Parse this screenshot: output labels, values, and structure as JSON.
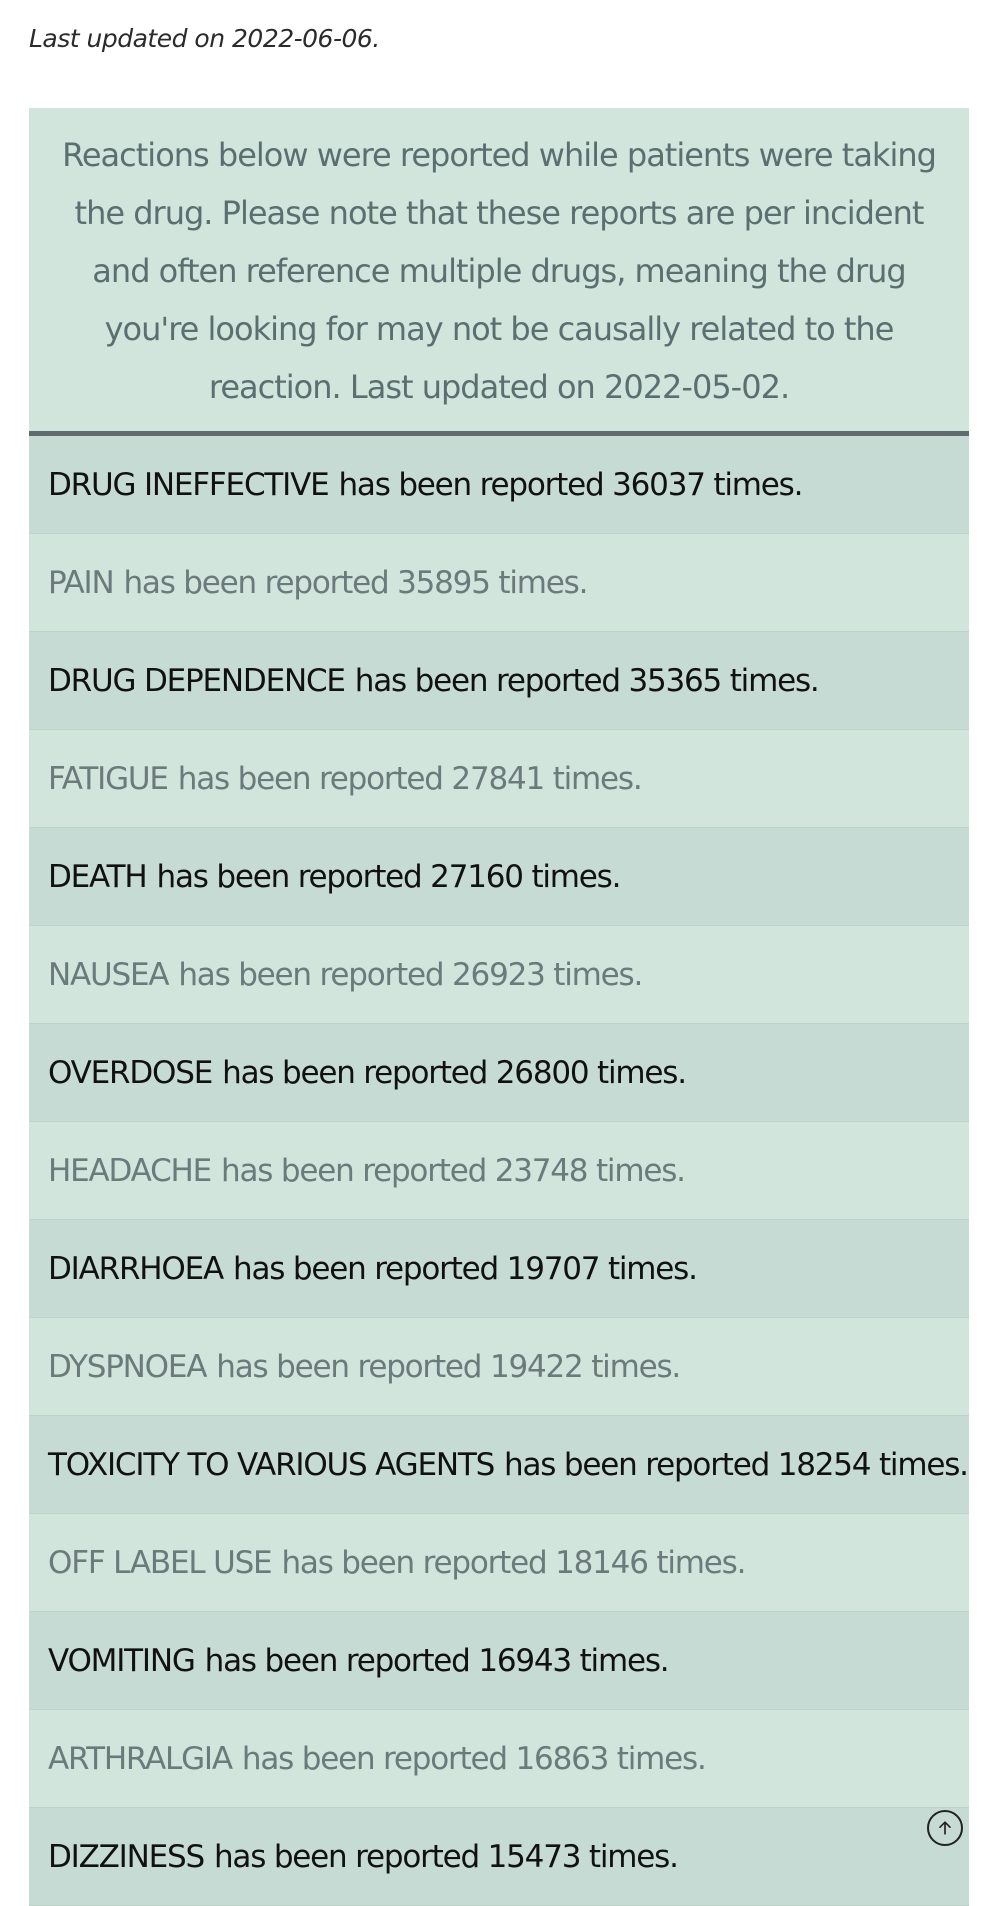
{
  "last_updated": "Last updated on 2022-06-06.",
  "intro": "Reactions below were reported while patients were taking the drug. Please note that these reports are per incident and often reference multiple drugs, meaning the drug you're looking for may not be causally related to the reaction. Last updated on 2022-05-02.",
  "reactions": [
    {
      "name": "DRUG INEFFECTIVE",
      "suffix": "has been reported 36037 times."
    },
    {
      "name": "PAIN",
      "suffix": "has been reported 35895 times."
    },
    {
      "name": "DRUG DEPENDENCE",
      "suffix": "has been reported 35365 times."
    },
    {
      "name": "FATIGUE",
      "suffix": "has been reported 27841 times."
    },
    {
      "name": "DEATH",
      "suffix": "has been reported 27160 times."
    },
    {
      "name": "NAUSEA",
      "suffix": "has been reported 26923 times."
    },
    {
      "name": "OVERDOSE",
      "suffix": "has been reported 26800 times."
    },
    {
      "name": "HEADACHE",
      "suffix": "has been reported 23748 times."
    },
    {
      "name": "DIARRHOEA",
      "suffix": "has been reported 19707 times."
    },
    {
      "name": "DYSPNOEA",
      "suffix": "has been reported 19422 times."
    },
    {
      "name": "TOXICITY TO VARIOUS AGENTS",
      "suffix": "has been reported 18254 times."
    },
    {
      "name": "OFF LABEL USE",
      "suffix": "has been reported 18146 times."
    },
    {
      "name": "VOMITING",
      "suffix": "has been reported 16943 times."
    },
    {
      "name": "ARTHRALGIA",
      "suffix": "has been reported 16863 times."
    },
    {
      "name": "DIZZINESS",
      "suffix": "has been reported 15473 times."
    }
  ],
  "scroll_top_icon": "arrow-up-circle-icon",
  "colors": {
    "row_dark": "#c6dbd3",
    "row_light": "#d1e5dd",
    "intro_text": "#5b6f70",
    "divider": "#5f6b6e"
  }
}
